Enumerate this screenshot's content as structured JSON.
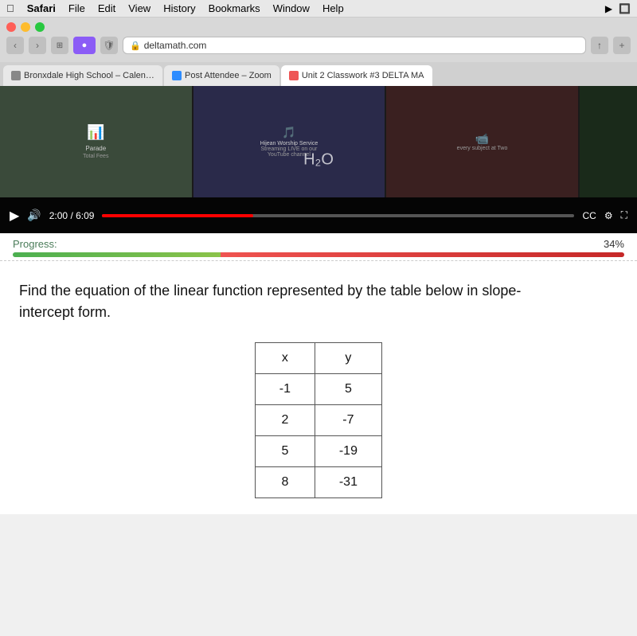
{
  "menu_bar": {
    "apple": "⌘",
    "items": [
      "Safari",
      "File",
      "Edit",
      "View",
      "History",
      "Bookmarks",
      "Window",
      "Help"
    ]
  },
  "browser": {
    "address": "deltamath.com",
    "tabs": [
      {
        "title": "Bronxdale High School – Calendar – Thursday,...",
        "active": false
      },
      {
        "title": "Post Attendee – Zoom",
        "active": false
      },
      {
        "title": "Unit 2 Classwork #3 DELTA MA",
        "active": true
      }
    ],
    "time": "2:00 / 6:09"
  },
  "progress": {
    "label": "Progress:",
    "percent": "34%",
    "green_width": "34%",
    "red_width": "66%"
  },
  "question": {
    "text": "Find the equation of the linear function represented by the table below in slope-intercept form."
  },
  "table": {
    "headers": [
      "x",
      "y"
    ],
    "rows": [
      [
        "-1",
        "5"
      ],
      [
        "2",
        "-7"
      ],
      [
        "5",
        "-19"
      ],
      [
        "8",
        "-31"
      ]
    ]
  },
  "video": {
    "center_text": "H₂O"
  }
}
